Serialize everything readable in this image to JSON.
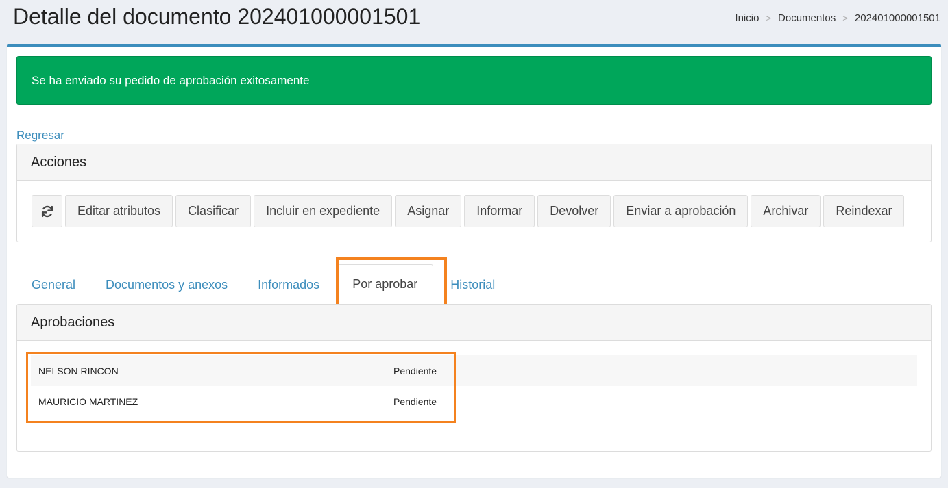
{
  "header": {
    "title": "Detalle del documento 202401000001501",
    "breadcrumb": [
      "Inicio",
      "Documentos",
      "202401000001501"
    ],
    "separator": ">"
  },
  "alert": {
    "message": "Se ha enviado su pedido de aprobación exitosamente",
    "color": "#00a65a"
  },
  "back_link": "Regresar",
  "actions": {
    "title": "Acciones",
    "refresh_icon": "refresh-icon",
    "buttons": [
      "Editar atributos",
      "Clasificar",
      "Incluir en expediente",
      "Asignar",
      "Informar",
      "Devolver",
      "Enviar a aprobación",
      "Archivar",
      "Reindexar"
    ]
  },
  "tabs": [
    {
      "label": "General"
    },
    {
      "label": "Documentos y anexos"
    },
    {
      "label": "Informados"
    },
    {
      "label": "Por aprobar",
      "active": true
    },
    {
      "label": "Historial"
    }
  ],
  "approvals": {
    "title": "Aprobaciones",
    "rows": [
      {
        "name": "NELSON RINCON",
        "status": "Pendiente"
      },
      {
        "name": "MAURICIO MARTINEZ",
        "status": "Pendiente"
      }
    ]
  },
  "colors": {
    "accent": "#3c8dbc",
    "highlight": "#f4821f",
    "success": "#00a65a"
  }
}
